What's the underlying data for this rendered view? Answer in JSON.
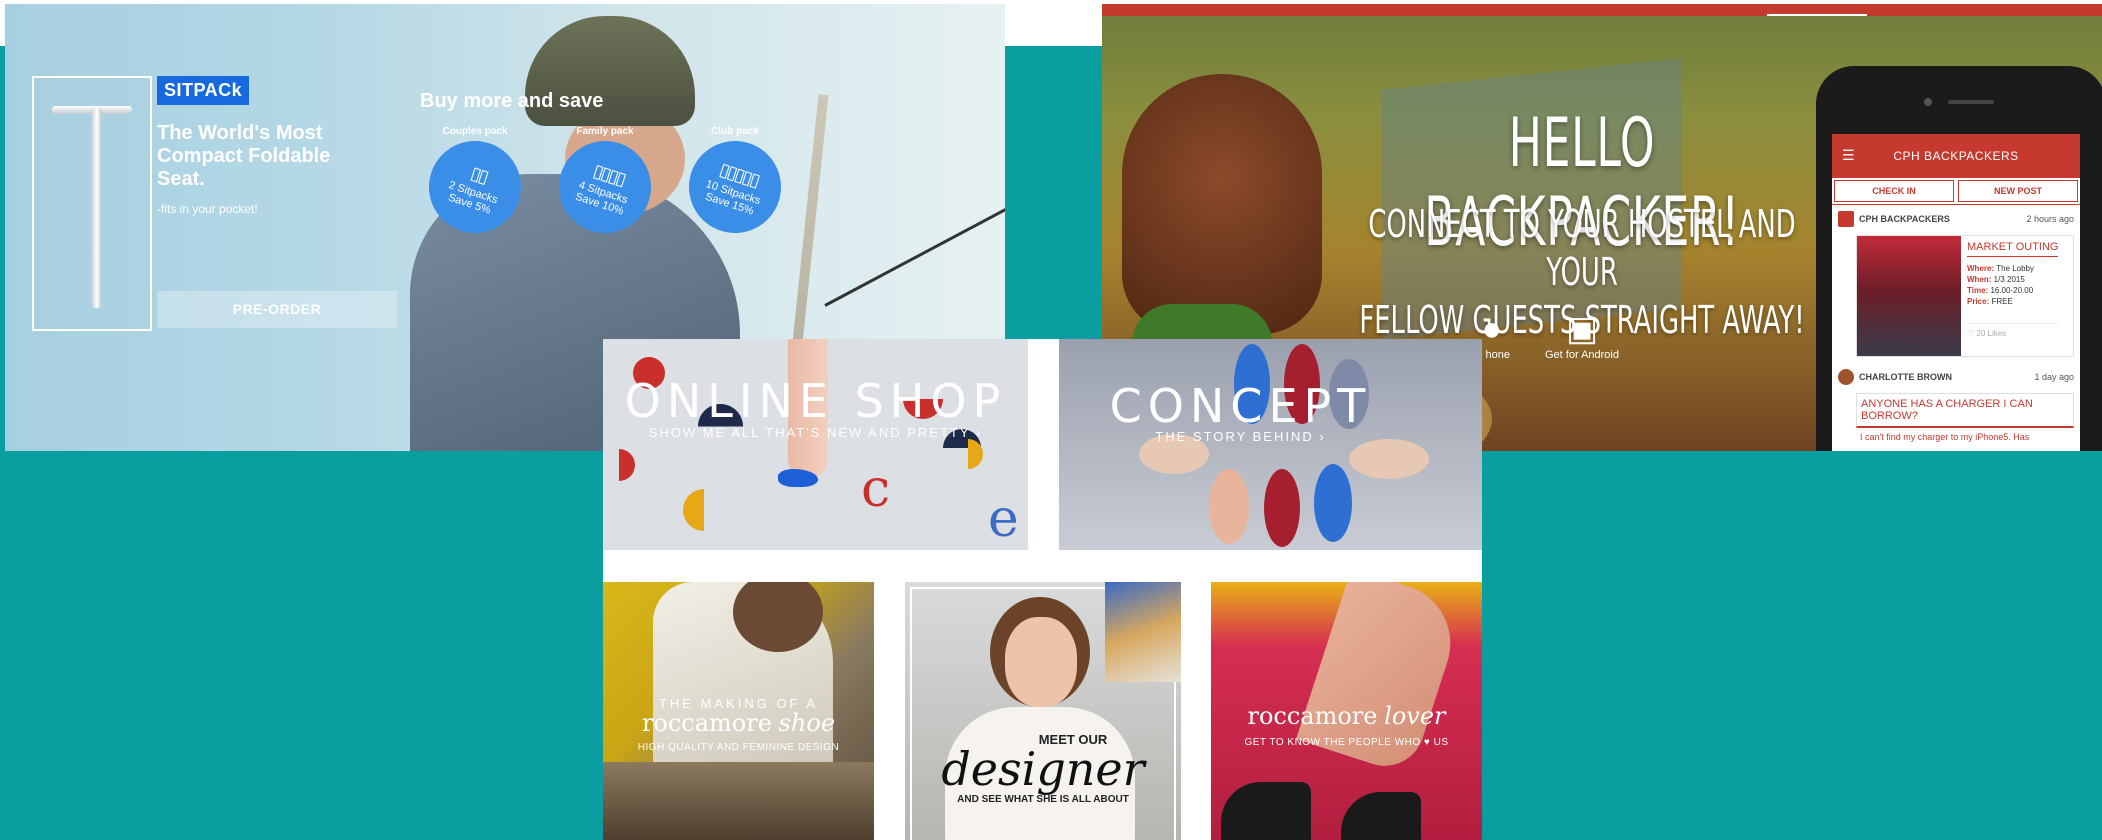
{
  "colors": {
    "background_teal": "#0b9ea1",
    "sitpack_blue": "#1769e0",
    "backpacker_red": "#c5392f"
  },
  "sitpack": {
    "logo": "SITPACk",
    "headline": "The World's Most Compact Foldable Seat.",
    "subline": "-fits in your pocket!",
    "preorder": "PRE-ORDER",
    "buy_more": "Buy more and save",
    "packs": [
      {
        "title": "Couples pack",
        "line1": "2 Sitpacks",
        "line2": "Save 5%"
      },
      {
        "title": "Family pack",
        "line1": "4 Sitpacks",
        "line2": "Save 10%"
      },
      {
        "title": "Club pack",
        "line1": "10 Sitpacks",
        "line2": "Save 15%"
      }
    ]
  },
  "backpacker": {
    "title": "HELLO BACKPACKER!",
    "subtitle_line1": "CONNECT TO YOUR HOSTEL AND YOUR",
    "subtitle_line2": "FELLOW GUESTS STRAIGHT AWAY!",
    "iphone_label": "hone",
    "android_label": "Get for Android",
    "app": {
      "title": "CPH BACKPACKERS",
      "tab_checkin": "CHECK IN",
      "tab_newpost": "NEW POST",
      "post1_author": "CPH BACKPACKERS",
      "post1_time": "2 hours ago",
      "event_title": "MARKET OUTING",
      "where_label": "Where:",
      "where": "The Lobby",
      "when_label": "When:",
      "when": "1/3 2015",
      "time_label": "Time:",
      "time": "16.00-20.00",
      "price_label": "Price:",
      "price": "FREE",
      "likes": "20 Likes",
      "post2_author": "CHARLOTTE BROWN",
      "post2_time": "1 day ago",
      "post2_title": "ANYONE HAS A CHARGER I CAN BORROW?",
      "post2_text": "I can't find my charger to my iPhone5. Has"
    }
  },
  "roccamore": {
    "shop_title": "ONLINE SHOP",
    "shop_sub": "SHOW ME ALL THAT'S NEW AND PRETTY ›",
    "concept_title": "CONCEPT",
    "concept_sub": "THE STORY BEHIND ›",
    "making_line1": "THE MAKING OF A",
    "making_brand": "roccamore",
    "making_script": "shoe",
    "making_sub": "HIGH QUALITY AND FEMININE DESIGN",
    "designer_meet": "MEET OUR",
    "designer_script": "designer",
    "designer_sub": "AND SEE WHAT SHE IS ALL ABOUT",
    "lover_brand": "roccamore",
    "lover_script": "lover",
    "lover_sub": "GET TO KNOW THE PEOPLE WHO ♥ US"
  }
}
